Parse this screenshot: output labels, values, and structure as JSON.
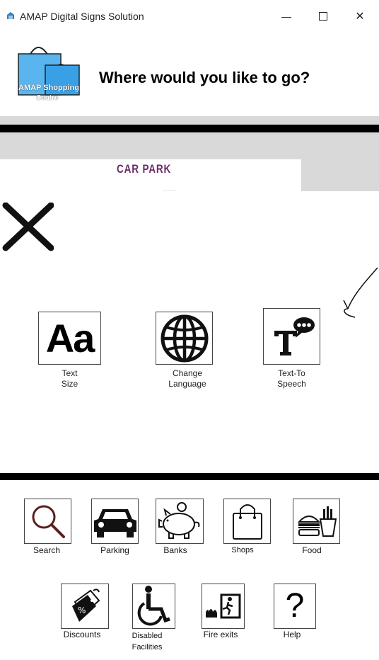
{
  "window": {
    "title": "AMAP Digital Signs Solution",
    "minimize_symbol": "—",
    "close_symbol": "✕"
  },
  "header": {
    "logo_line1": "AMAP Shopping",
    "logo_line2": "Centre",
    "title": "Where would you like to go?"
  },
  "map": {
    "location_label": "CAR PARK"
  },
  "accessibility": {
    "text_size_glyph": "Aa",
    "text_size_label_1": "Text",
    "text_size_label_2": "Size",
    "language_label_1": "Change",
    "language_label_2": "Language",
    "tts_label_1": "Text-To",
    "tts_label_2": "Speech"
  },
  "nav": {
    "row1": [
      "Search",
      "Parking",
      "Banks",
      "Shops",
      "Food"
    ],
    "row2": [
      "Discounts",
      "Disabled",
      "Facilities",
      "Fire exits",
      "Help"
    ]
  },
  "help_glyph": "?"
}
